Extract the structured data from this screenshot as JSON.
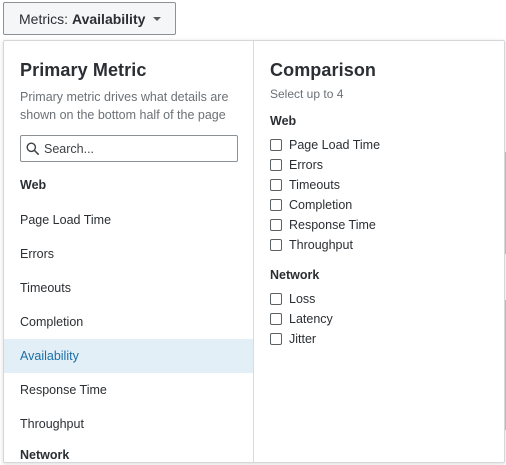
{
  "trigger": {
    "prefix": "Metrics:",
    "value": "Availability"
  },
  "primary": {
    "title": "Primary Metric",
    "description": "Primary metric drives what details are shown on the bottom half of the page",
    "search_placeholder": "Search...",
    "groups": [
      {
        "label": "Web",
        "items": [
          {
            "label": "Page Load Time",
            "selected": false
          },
          {
            "label": "Errors",
            "selected": false
          },
          {
            "label": "Timeouts",
            "selected": false
          },
          {
            "label": "Completion",
            "selected": false
          },
          {
            "label": "Availability",
            "selected": true
          },
          {
            "label": "Response Time",
            "selected": false
          },
          {
            "label": "Throughput",
            "selected": false
          }
        ]
      },
      {
        "label": "Network",
        "items": []
      }
    ]
  },
  "comparison": {
    "title": "Comparison",
    "subtitle": "Select up to 4",
    "groups": [
      {
        "label": "Web",
        "items": [
          {
            "label": "Page Load Time",
            "checked": false
          },
          {
            "label": "Errors",
            "checked": false
          },
          {
            "label": "Timeouts",
            "checked": false
          },
          {
            "label": "Completion",
            "checked": false
          },
          {
            "label": "Response Time",
            "checked": false
          },
          {
            "label": "Throughput",
            "checked": false
          }
        ]
      },
      {
        "label": "Network",
        "items": [
          {
            "label": "Loss",
            "checked": false
          },
          {
            "label": "Latency",
            "checked": false
          },
          {
            "label": "Jitter",
            "checked": false
          }
        ]
      }
    ]
  },
  "colors": {
    "selected_bg": "#e3eff7",
    "selected_text": "#1a6fa8",
    "border": "#8c9196"
  },
  "icons": {
    "trigger_caret": "chevron-down-icon",
    "search": "search-icon"
  }
}
